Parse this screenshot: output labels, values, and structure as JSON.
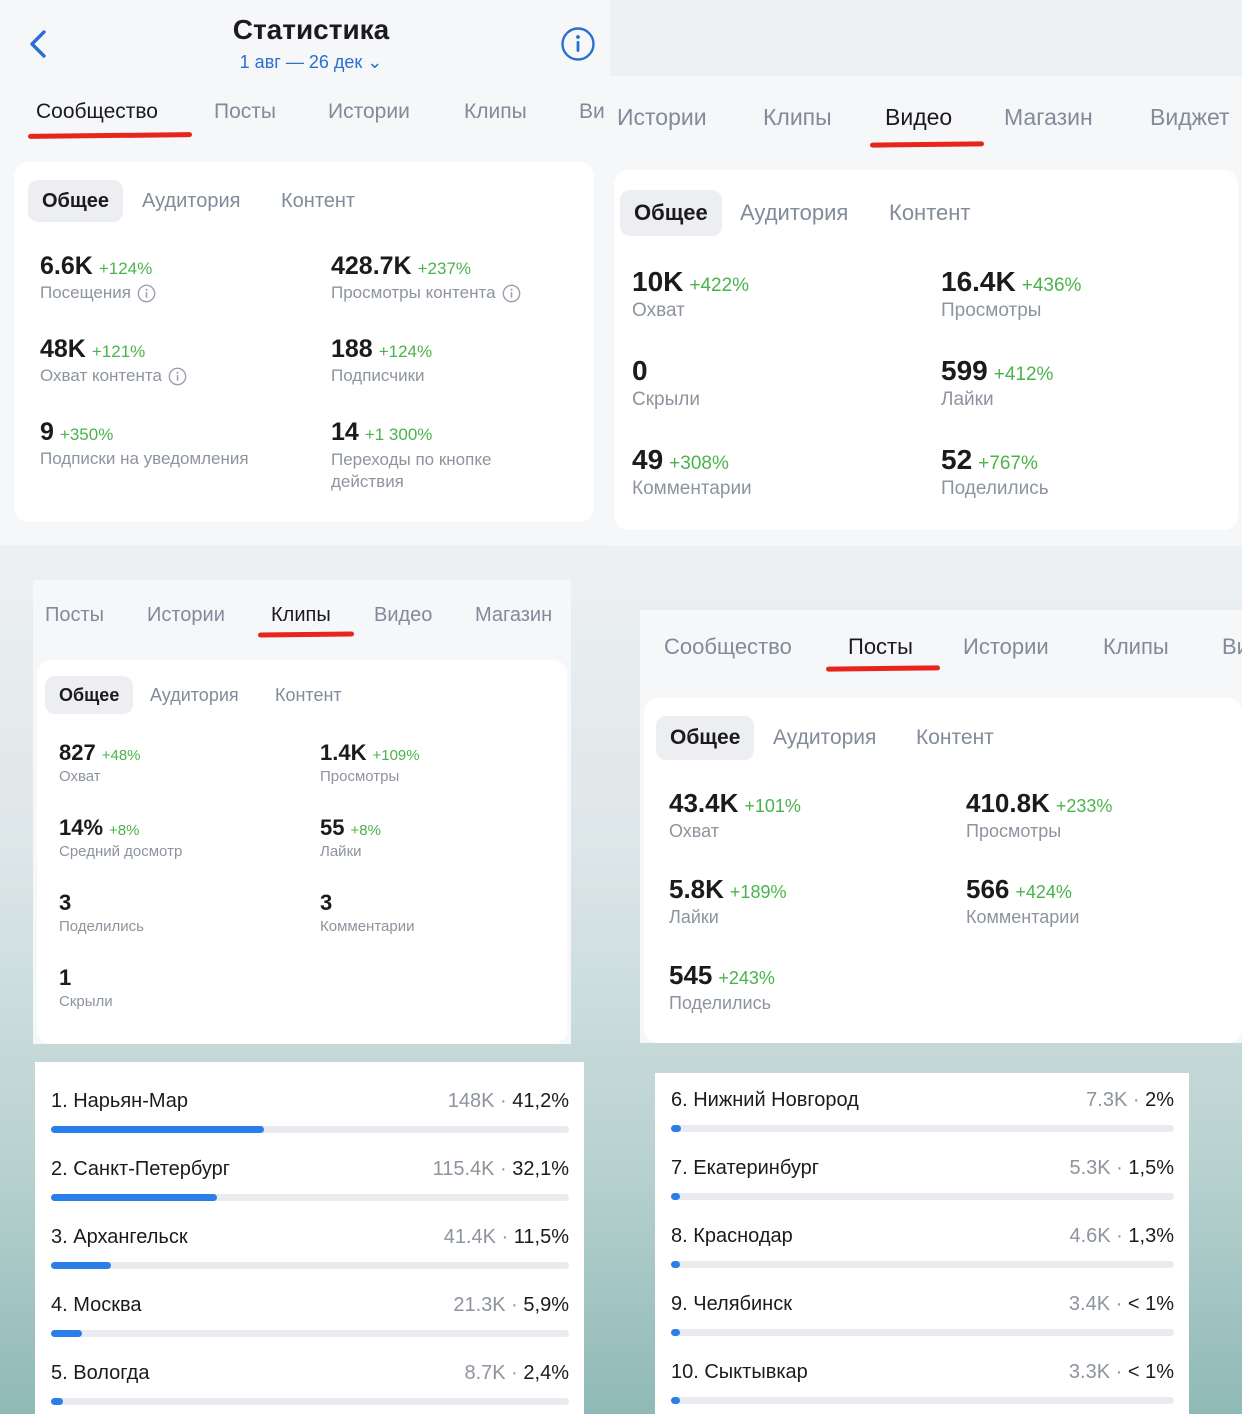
{
  "header": {
    "title": "Статистика",
    "period": "1 авг — 26 дек ⌄"
  },
  "panel_community": {
    "tabs": [
      "Сообщество",
      "Посты",
      "Истории",
      "Клипы",
      "Ви"
    ],
    "segments": [
      "Общее",
      "Аудитория",
      "Контент"
    ],
    "metrics": [
      {
        "value": "6.6K",
        "change": "+124%",
        "label": "Посещения"
      },
      {
        "value": "428.7K",
        "change": "+237%",
        "label": "Просмотры контента"
      },
      {
        "value": "48K",
        "change": "+121%",
        "label": "Охват контента"
      },
      {
        "value": "188",
        "change": "+124%",
        "label": "Подписчики"
      },
      {
        "value": "9",
        "change": "+350%",
        "label": "Подписки на уведомления"
      },
      {
        "value": "14",
        "change": "+1 300%",
        "label": "Переходы по кнопке действия"
      }
    ]
  },
  "panel_video": {
    "tabs": [
      "Истории",
      "Клипы",
      "Видео",
      "Магазин",
      "Виджет"
    ],
    "segments": [
      "Общее",
      "Аудитория",
      "Контент"
    ],
    "metrics": [
      {
        "value": "10K",
        "change": "+422%",
        "label": "Охват"
      },
      {
        "value": "16.4K",
        "change": "+436%",
        "label": "Просмотры"
      },
      {
        "value": "0",
        "change": "",
        "label": "Скрыли"
      },
      {
        "value": "599",
        "change": "+412%",
        "label": "Лайки"
      },
      {
        "value": "49",
        "change": "+308%",
        "label": "Комментарии"
      },
      {
        "value": "52",
        "change": "+767%",
        "label": "Поделились"
      }
    ]
  },
  "panel_clips": {
    "tabs": [
      "Посты",
      "Истории",
      "Клипы",
      "Видео",
      "Магазин"
    ],
    "segments": [
      "Общее",
      "Аудитория",
      "Контент"
    ],
    "metrics": [
      {
        "value": "827",
        "change": "+48%",
        "label": "Охват"
      },
      {
        "value": "1.4K",
        "change": "+109%",
        "label": "Просмотры"
      },
      {
        "value": "14%",
        "change": "+8%",
        "label": "Средний досмотр"
      },
      {
        "value": "55",
        "change": "+8%",
        "label": "Лайки"
      },
      {
        "value": "3",
        "change": "",
        "label": "Поделились"
      },
      {
        "value": "3",
        "change": "",
        "label": "Комментарии"
      },
      {
        "value": "1",
        "change": "",
        "label": "Скрыли"
      }
    ]
  },
  "panel_posts": {
    "tabs": [
      "Сообщество",
      "Посты",
      "Истории",
      "Клипы",
      "Ви"
    ],
    "segments": [
      "Общее",
      "Аудитория",
      "Контент"
    ],
    "metrics": [
      {
        "value": "43.4K",
        "change": "+101%",
        "label": "Охват"
      },
      {
        "value": "410.8K",
        "change": "+233%",
        "label": "Просмотры"
      },
      {
        "value": "5.8K",
        "change": "+189%",
        "label": "Лайки"
      },
      {
        "value": "566",
        "change": "+424%",
        "label": "Комментарии"
      },
      {
        "value": "545",
        "change": "+243%",
        "label": "Поделились"
      }
    ]
  },
  "cities_left": [
    {
      "name": "1. Нарьян-Мар",
      "count": "148K",
      "pct": "41,2%",
      "share": 0.412
    },
    {
      "name": "2. Санкт-Петербург",
      "count": "115.4K",
      "pct": "32,1%",
      "share": 0.321
    },
    {
      "name": "3. Архангельск",
      "count": "41.4K",
      "pct": "11,5%",
      "share": 0.115
    },
    {
      "name": "4. Москва",
      "count": "21.3K",
      "pct": "5,9%",
      "share": 0.059
    },
    {
      "name": "5. Вологда",
      "count": "8.7K",
      "pct": "2,4%",
      "share": 0.024
    }
  ],
  "cities_right": [
    {
      "name": "6. Нижний Новгород",
      "count": "7.3K",
      "pct": "2%",
      "share": 0.02
    },
    {
      "name": "7. Екатеринбург",
      "count": "5.3K",
      "pct": "1,5%",
      "share": 0.015
    },
    {
      "name": "8. Краснодар",
      "count": "4.6K",
      "pct": "1,3%",
      "share": 0.013
    },
    {
      "name": "9. Челябинск",
      "count": "3.4K",
      "pct": "< 1%",
      "share": 0.01
    },
    {
      "name": "10. Сыктывкар",
      "count": "3.3K",
      "pct": "< 1%",
      "share": 0.009
    }
  ],
  "colors": {
    "accent": "#2a6fd1",
    "positive": "#4bb34b",
    "highlight": "#e8251a",
    "bar": "#2b7de9"
  }
}
